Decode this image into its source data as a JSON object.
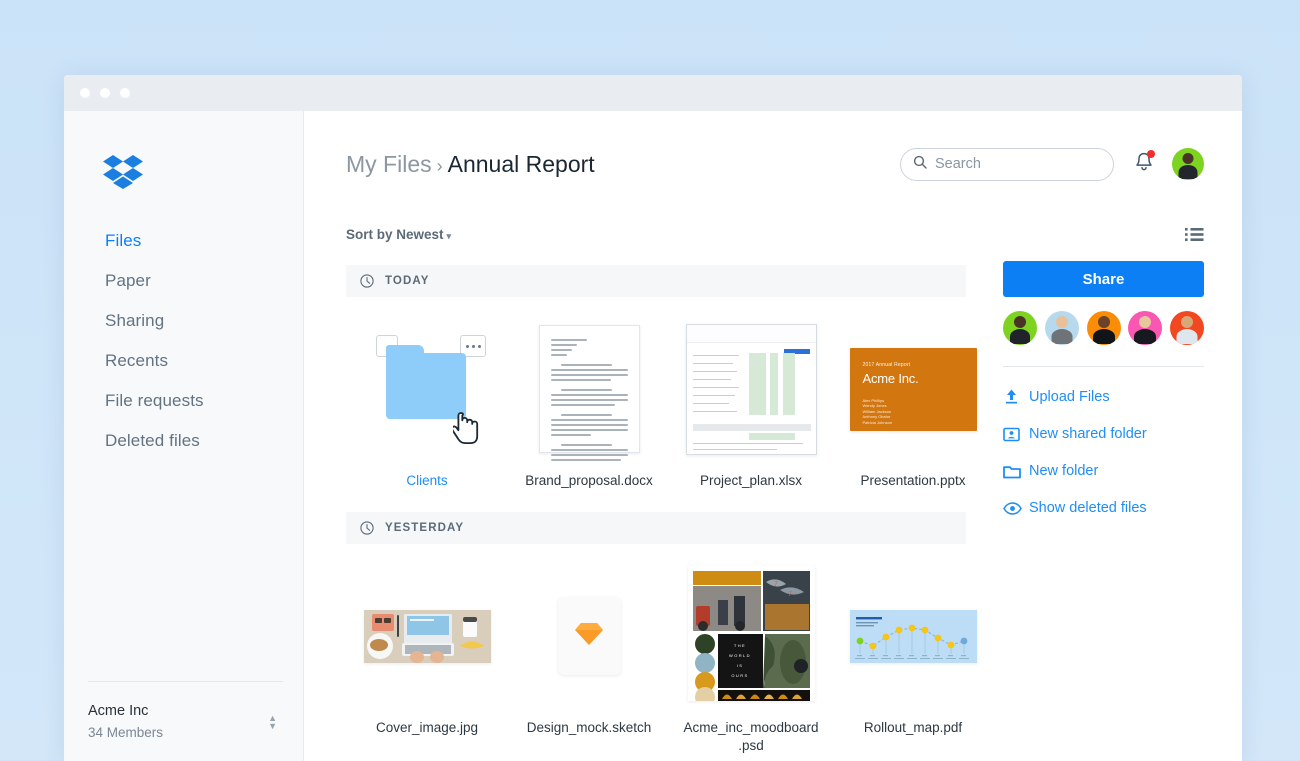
{
  "window": {
    "dots": [
      "close-dot",
      "minimize-dot",
      "maximize-dot"
    ]
  },
  "sidebar": {
    "logo": "dropbox-logo",
    "items": [
      {
        "label": "Files",
        "active": true
      },
      {
        "label": "Paper",
        "active": false
      },
      {
        "label": "Sharing",
        "active": false
      },
      {
        "label": "Recents",
        "active": false
      },
      {
        "label": "File requests",
        "active": false
      },
      {
        "label": "Deleted files",
        "active": false
      }
    ],
    "team": {
      "name": "Acme Inc",
      "members": "34 Members"
    }
  },
  "header": {
    "breadcrumb": {
      "parent": "My Files",
      "separator": "›",
      "current": "Annual Report"
    },
    "search": {
      "value": "",
      "placeholder": "Search",
      "icon": "search-icon"
    },
    "bell": {
      "icon": "bell-icon",
      "has_notification": true
    },
    "avatar": {
      "name": "user-avatar",
      "color": "#7ed321"
    }
  },
  "toolbar": {
    "sort_label": "Sort by Newest",
    "sort_caret": "▾",
    "view_icon": "list-view-icon"
  },
  "sections": [
    {
      "name": "TODAY",
      "icon": "clock-icon",
      "files": [
        {
          "label": "Clients",
          "kind": "folder",
          "is_link": true,
          "selected": false,
          "has_menu": true,
          "has_cursor": true
        },
        {
          "label": "Brand_proposal.docx",
          "kind": "document",
          "is_link": false
        },
        {
          "label": "Project_plan.xlsx",
          "kind": "spreadsheet",
          "is_link": false
        },
        {
          "label": "Presentation.pptx",
          "kind": "presentation",
          "is_link": false
        }
      ]
    },
    {
      "name": "YESTERDAY",
      "icon": "clock-icon",
      "files": [
        {
          "label": "Cover_image.jpg",
          "kind": "photo",
          "is_link": false
        },
        {
          "label": "Design_mock.sketch",
          "kind": "sketch",
          "is_link": false
        },
        {
          "label": "Acme_inc_moodboard\n.psd",
          "kind": "moodboard",
          "is_link": false
        },
        {
          "label": "Rollout_map.pdf",
          "kind": "chart-pdf",
          "is_link": false
        }
      ]
    }
  ],
  "presentation_slide": {
    "kicker": "2017 Annual Report",
    "title": "Acme Inc.",
    "names": [
      "Alex Phillips",
      "Wendy Jones",
      "William Jackson",
      "Anthony Okafor",
      "Patricia Johnson"
    ]
  },
  "moodboard": {
    "text_lines": [
      "THE",
      "WORLD",
      "IS",
      "OURS"
    ],
    "swatches": [
      "#2e4227",
      "#8fb4c4",
      "#d79a1c",
      "#e3cfa3"
    ]
  },
  "right_panel": {
    "share_label": "Share",
    "avatars": [
      {
        "name": "member-avatar-1",
        "color": "#7ed321"
      },
      {
        "name": "member-avatar-2",
        "color": "#b6d9ee"
      },
      {
        "name": "member-avatar-3",
        "color": "#fb8c05"
      },
      {
        "name": "member-avatar-4",
        "color": "#f957b2"
      },
      {
        "name": "member-avatar-5",
        "color": "#f24822"
      }
    ],
    "actions": [
      {
        "label": "Upload Files",
        "icon": "upload-icon"
      },
      {
        "label": "New shared folder",
        "icon": "shared-folder-icon"
      },
      {
        "label": "New folder",
        "icon": "folder-icon"
      },
      {
        "label": "Show deleted files",
        "icon": "eye-icon"
      }
    ]
  },
  "colors": {
    "accent": "#0d7ff5",
    "link": "#1e8ef5",
    "folder": "#8ecdfa",
    "slide": "#d2760f",
    "notification": "#ef2e2e",
    "page_bg": "#cfe4f7"
  }
}
